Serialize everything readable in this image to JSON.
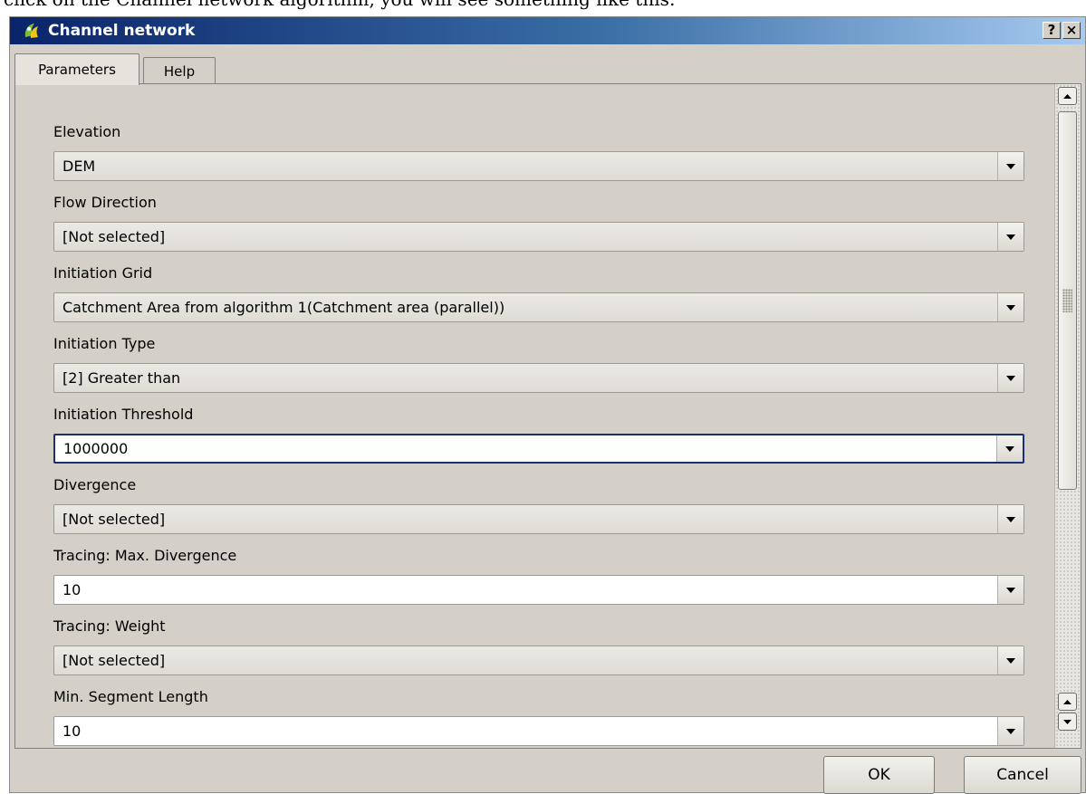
{
  "caption": "click on the Channel network algorithm, you will see something like this:",
  "window": {
    "title": "Channel network",
    "help_button": "?",
    "close_button": "×"
  },
  "tabs": [
    {
      "label": "Parameters",
      "active": true
    },
    {
      "label": "Help",
      "active": false
    }
  ],
  "fields": [
    {
      "label": "Elevation",
      "value": "DEM",
      "editable": false
    },
    {
      "label": "Flow Direction",
      "value": "[Not selected]",
      "editable": false
    },
    {
      "label": "Initiation Grid",
      "value": "Catchment Area from algorithm 1(Catchment area (parallel))",
      "editable": false
    },
    {
      "label": "Initiation Type",
      "value": "[2] Greater than",
      "editable": false
    },
    {
      "label": "Initiation Threshold",
      "value": "1000000",
      "editable": true,
      "focused": true
    },
    {
      "label": "Divergence",
      "value": "[Not selected]",
      "editable": false
    },
    {
      "label": "Tracing: Max. Divergence",
      "value": "10",
      "editable": true
    },
    {
      "label": "Tracing: Weight",
      "value": "[Not selected]",
      "editable": false
    },
    {
      "label": "Min. Segment Length",
      "value": "10",
      "editable": true
    }
  ],
  "buttons": {
    "ok": "OK",
    "cancel": "Cancel"
  },
  "icons": {
    "app": "qgis-logo-icon",
    "combo_arrow": "chevron-down-icon"
  },
  "colors": {
    "title_gradient_start": "#0a246a",
    "title_gradient_end": "#a6caf0",
    "dialog_bg": "#d4d0c8",
    "focus_border": "#1c2f74"
  }
}
